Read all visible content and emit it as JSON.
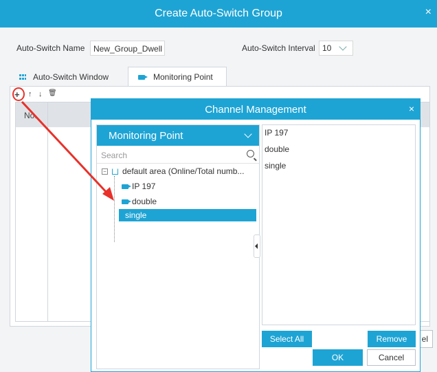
{
  "window": {
    "title": "Create Auto-Switch Group",
    "close": "×"
  },
  "form": {
    "name_label": "Auto-Switch Name",
    "name_value": "New_Group_Dwell",
    "interval_label": "Auto-Switch Interval",
    "interval_value": "10"
  },
  "tabs": [
    {
      "label": "Auto-Switch Window",
      "active": false
    },
    {
      "label": "Monitoring Point",
      "active": true
    }
  ],
  "toolbar": {
    "add": "+",
    "up": "↑",
    "down": "↓",
    "delete": "🗑"
  },
  "list": {
    "column_no": "No."
  },
  "partial_cancel": "el",
  "dialog": {
    "title": "Channel Management",
    "close": "×",
    "dropdown_label": "Monitoring Point",
    "search_placeholder": "Search",
    "tree_root": "default area (Online/Total numb...",
    "tree_items": [
      "IP 197",
      "double",
      "single"
    ],
    "selected_item": "single",
    "selected_list": [
      "IP 197",
      "double",
      "single"
    ],
    "select_all": "Select All",
    "remove": "Remove",
    "ok": "OK",
    "cancel": "Cancel"
  },
  "colors": {
    "accent": "#1ea4d4",
    "annotation": "#e8312a"
  }
}
